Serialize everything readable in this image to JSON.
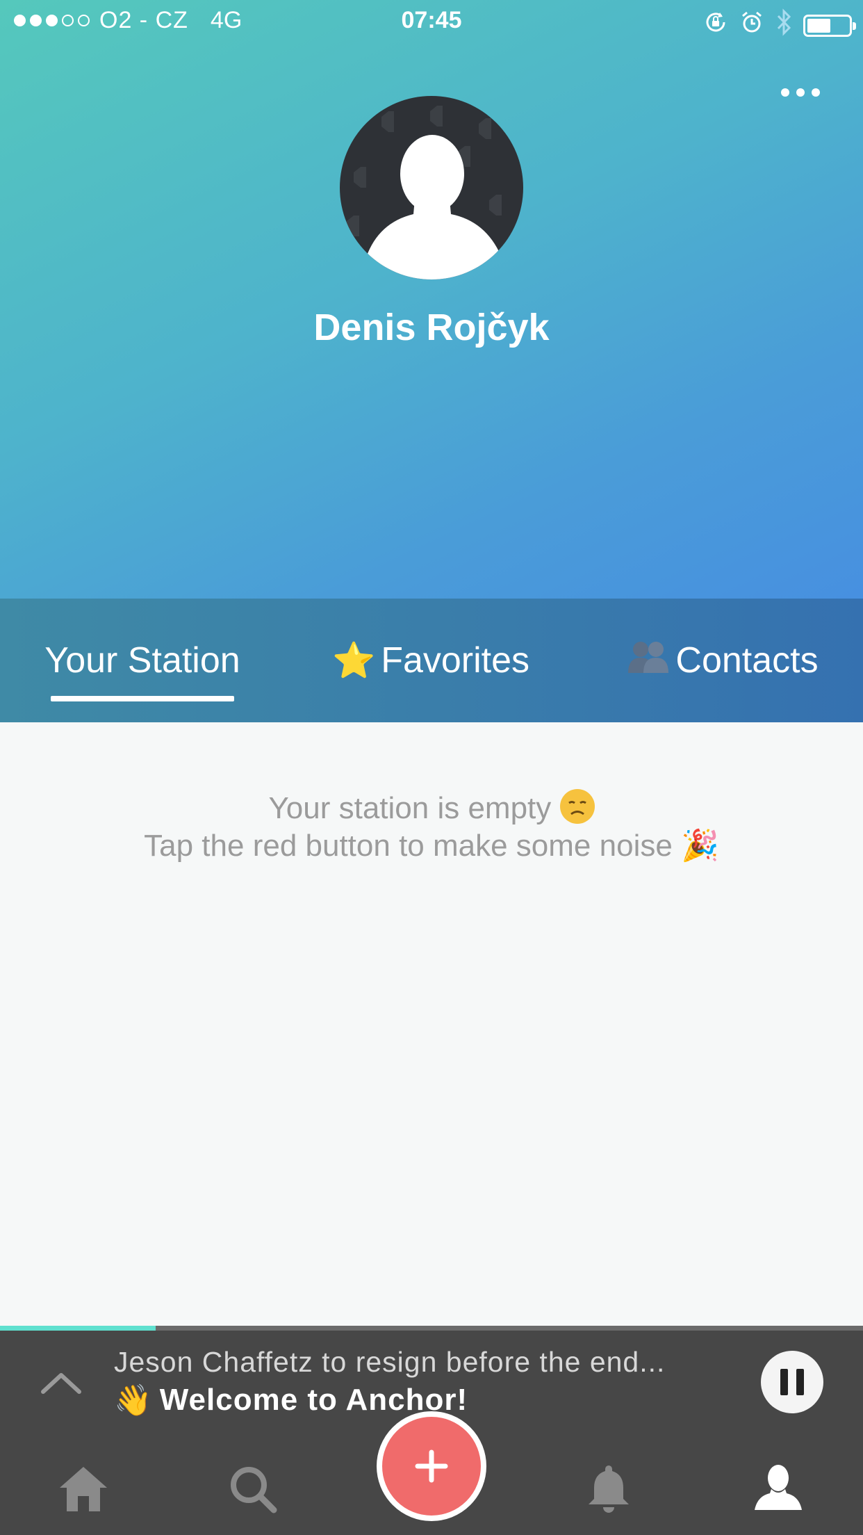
{
  "status_bar": {
    "signal_filled": 3,
    "signal_total": 5,
    "carrier": "O2 - CZ",
    "network": "4G",
    "time": "07:45",
    "battery_level": 0.52
  },
  "profile": {
    "name": "Denis Rojčyk"
  },
  "tabs": [
    {
      "label": "Your Station",
      "emoji": "",
      "active": true
    },
    {
      "label": "Favorites",
      "emoji": "⭐",
      "active": false
    },
    {
      "label": "Contacts",
      "emoji": "👥",
      "active": false
    }
  ],
  "empty_state": {
    "line1": "Your station is empty",
    "line2": "Tap the red button to make some noise",
    "line2_emoji": "🎉"
  },
  "player": {
    "title": "Jeson Chaffetz to resign before the end...",
    "subtitle": "Welcome to Anchor!",
    "subtitle_emoji": "👋",
    "progress": 0.18
  },
  "nav": {
    "items": [
      "home-icon",
      "search-icon",
      "record-button",
      "bell-icon",
      "profile-icon"
    ]
  },
  "colors": {
    "accent_red": "#f06b6b",
    "progress_teal": "#5fe0cf",
    "player_bg": "#474747"
  }
}
